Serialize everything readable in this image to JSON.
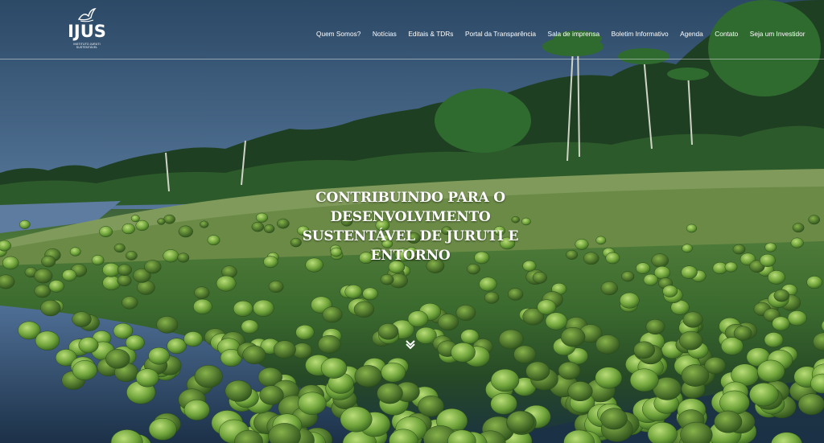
{
  "logo": {
    "mark": "IJUS",
    "subtitle": "INSTITUTO JURUTI SUSTENTÁVEL"
  },
  "nav": {
    "items": [
      "Quem Somos?",
      "Notícias",
      "Editais & TDRs",
      "Portal da Transparência",
      "Sala de imprensa",
      "Boletim Informativo",
      "Agenda",
      "Contato",
      "Seja um Investidor"
    ]
  },
  "hero": {
    "headline_line1": "Contribuindo para o desenvolvimento",
    "headline_line2": "sustentável de Juruti e entorno"
  },
  "icons": {
    "scroll": "chevron-down-icon",
    "logo_bird": "bird-icon"
  }
}
